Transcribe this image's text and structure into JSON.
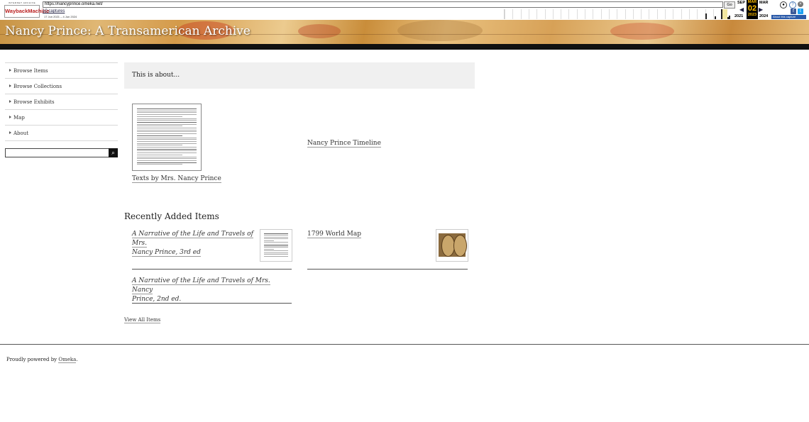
{
  "wayback": {
    "logo_small": "INTERNET ARCHIVE",
    "logo_big": "WaybackMachine",
    "url": "https://nancyprince.omeka.net/",
    "go_label": "Go",
    "captures": "10 captures",
    "range": "17 Jun 2021 – 4 Jun 2024",
    "prev_month": "SEP",
    "cur_month": "MAR",
    "next_month": "MAR",
    "cur_day": "02",
    "prev_year": "2021",
    "cur_year": "2023",
    "next_year": "2024",
    "about_label": "About this capture"
  },
  "site": {
    "title": "Nancy Prince: A Transamerican Archive"
  },
  "nav": [
    {
      "label": "Browse Items"
    },
    {
      "label": "Browse Collections"
    },
    {
      "label": "Browse Exhibits"
    },
    {
      "label": "Map"
    },
    {
      "label": "About"
    }
  ],
  "search": {
    "placeholder": "",
    "icon": "search-icon"
  },
  "intro": {
    "text": "This is about..."
  },
  "featured": [
    {
      "title": "Texts by Mrs. Nancy Prince"
    },
    {
      "title": "Nancy Prince Timeline"
    }
  ],
  "recent": {
    "heading": "Recently Added Items",
    "items": [
      {
        "title_line1": "A Narrative of the Life and Travels of Mrs.",
        "title_line2": "Nancy Prince, 3rd ed"
      },
      {
        "title_line1": "1799 World Map",
        "title_line2": ""
      },
      {
        "title_line1": "A Narrative of the Life and Travels of Mrs. Nancy",
        "title_line2": "Prince, 2nd ed."
      }
    ],
    "view_all": "View All Items"
  },
  "footer": {
    "prefix": "Proudly powered by ",
    "link": "Omeka",
    "suffix": "."
  }
}
